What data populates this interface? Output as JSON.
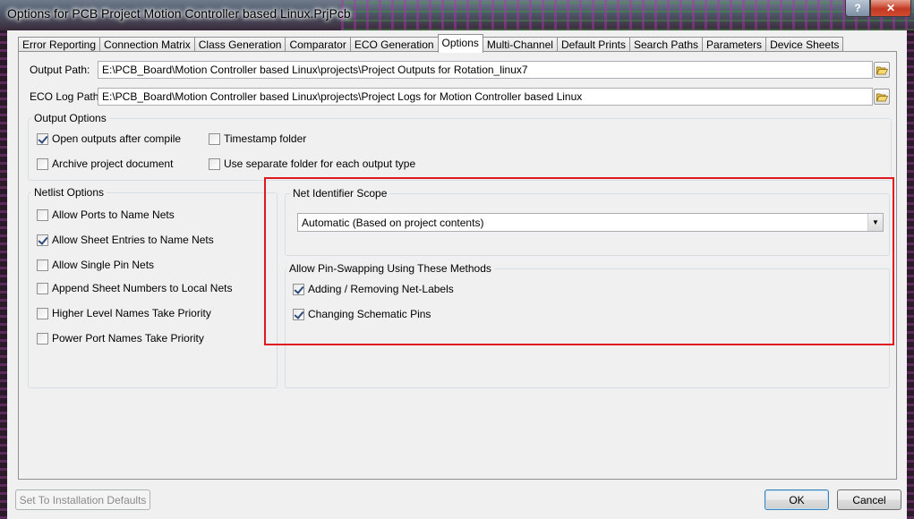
{
  "window": {
    "title": "Options for PCB Project Motion Controller based Linux.PrjPcb",
    "help_label": "?",
    "close_label": "✕"
  },
  "tabs": [
    {
      "label": "Error Reporting"
    },
    {
      "label": "Connection Matrix"
    },
    {
      "label": "Class Generation"
    },
    {
      "label": "Comparator"
    },
    {
      "label": "ECO Generation"
    },
    {
      "label": "Options",
      "active": true
    },
    {
      "label": "Multi-Channel"
    },
    {
      "label": "Default Prints"
    },
    {
      "label": "Search Paths"
    },
    {
      "label": "Parameters"
    },
    {
      "label": "Device Sheets"
    }
  ],
  "paths": {
    "output_label": "Output Path:",
    "output_value": "E:\\PCB_Board\\Motion Controller based Linux\\projects\\Project Outputs for Rotation_linux7",
    "eco_label": "ECO Log Path:",
    "eco_value": "E:\\PCB_Board\\Motion Controller based Linux\\projects\\Project Logs for Motion Controller based Linux",
    "browse_icon": "folder-open-icon"
  },
  "output_options": {
    "title": "Output Options",
    "items": [
      {
        "label": "Open outputs after compile",
        "checked": true
      },
      {
        "label": "Timestamp folder",
        "checked": false
      },
      {
        "label": "Archive project document",
        "checked": false
      },
      {
        "label": "Use separate folder for each output type",
        "checked": false
      }
    ]
  },
  "netlist_options": {
    "title": "Netlist Options",
    "items": [
      {
        "label": "Allow Ports to Name Nets",
        "checked": false
      },
      {
        "label": "Allow Sheet Entries to Name Nets",
        "checked": true
      },
      {
        "label": "Allow Single Pin Nets",
        "checked": false
      },
      {
        "label": "Append Sheet Numbers to Local Nets",
        "checked": false
      },
      {
        "label": "Higher Level Names Take Priority",
        "checked": false
      },
      {
        "label": "Power Port Names Take Priority",
        "checked": false
      }
    ]
  },
  "net_identifier": {
    "title": "Net Identifier Scope",
    "selected": "Automatic (Based on project contents)"
  },
  "pin_swapping": {
    "title": "Allow Pin-Swapping Using These Methods",
    "items": [
      {
        "label": "Adding / Removing Net-Labels",
        "checked": true
      },
      {
        "label": "Changing Schematic Pins",
        "checked": true
      }
    ]
  },
  "buttons": {
    "defaults_label": "Set To Installation Defaults",
    "ok_label": "OK",
    "cancel_label": "Cancel"
  },
  "colors": {
    "highlight_box": "#e0191f"
  }
}
